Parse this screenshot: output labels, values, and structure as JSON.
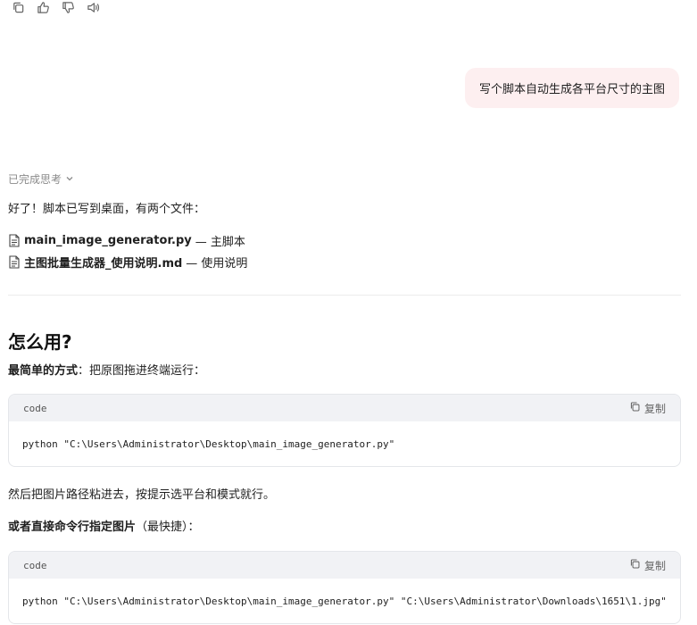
{
  "toolbar": {
    "icons": [
      "copy-icon",
      "thumbs-up-icon",
      "thumbs-down-icon",
      "speaker-icon"
    ]
  },
  "user_message": "写个脚本自动生成各平台尺寸的主图",
  "thinking": {
    "label": "已完成思考"
  },
  "reply": {
    "intro": "好了！脚本已写到桌面，有两个文件：",
    "files": [
      {
        "name": "main_image_generator.py",
        "desc": " — 主脚本"
      },
      {
        "name": "主图批量生成器_使用说明.md",
        "desc": " — 使用说明"
      }
    ],
    "heading": "怎么用?",
    "simple_bold": "最简单的方式",
    "simple_rest": "：把原图拖进终端运行：",
    "code1": {
      "lang": "code",
      "copy_label": "复制",
      "content": "python \"C:\\Users\\Administrator\\Desktop\\main_image_generator.py\""
    },
    "after_code1": "然后把图片路径粘进去，按提示选平台和模式就行。",
    "direct_bold": "或者直接命令行指定图片",
    "direct_rest": "（最快捷）：",
    "code2": {
      "lang": "code",
      "copy_label": "复制",
      "content": "python \"C:\\Users\\Administrator\\Desktop\\main_image_generator.py\" \"C:\\Users\\Administrator\\Downloads\\1651\\1.jpg\""
    }
  },
  "colors": {
    "user_bubble": "#fdeff0",
    "code_header": "#f1f2f5",
    "muted": "#8a8a8a"
  }
}
